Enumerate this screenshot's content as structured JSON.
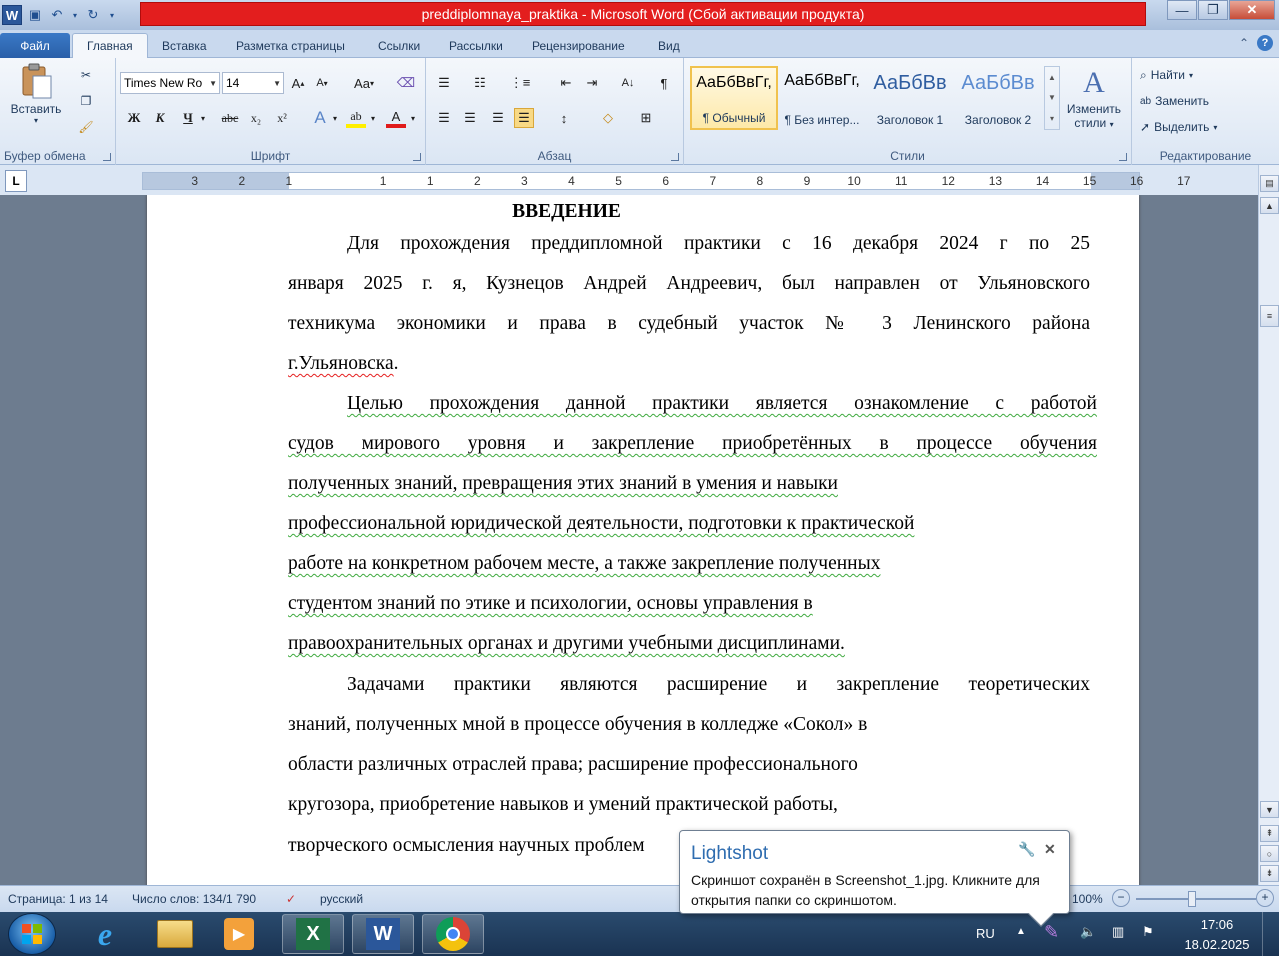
{
  "window": {
    "title": "preddiplomnaya_praktika  -  Microsoft Word (Сбой активации продукта)",
    "app_icon": "W"
  },
  "tabs": [
    "Файл",
    "Главная",
    "Вставка",
    "Разметка страницы",
    "Ссылки",
    "Рассылки",
    "Рецензирование",
    "Вид"
  ],
  "ribbon": {
    "clipboard": {
      "paste_label": "Вставить",
      "group_label": "Буфер обмена"
    },
    "font": {
      "name": "Times New Ro",
      "size": "14",
      "group_label": "Шрифт",
      "grow": "A",
      "shrink": "A",
      "case": "Aa",
      "bold": "Ж",
      "italic": "К",
      "underline": "Ч",
      "strike": "abc",
      "sub": "x₂",
      "sup": "x²"
    },
    "paragraph": {
      "group_label": "Абзац"
    },
    "styles": {
      "group_label": "Стили",
      "items": [
        {
          "sample": "АаБбВвГг,",
          "name": "¶ Обычный"
        },
        {
          "sample": "АаБбВвГг,",
          "name": "¶ Без интер..."
        },
        {
          "sample": "АаБбВв",
          "name": "Заголовок 1"
        },
        {
          "sample": "АаБбВв",
          "name": "Заголовок 2"
        }
      ],
      "change_label_1": "Изменить",
      "change_label_2": "стили"
    },
    "editing": {
      "find": "Найти",
      "replace": "Заменить",
      "select": "Выделить",
      "group_label": "Редактирование"
    }
  },
  "ruler": {
    "numbers": [
      "3",
      "2",
      "1",
      "1",
      "1",
      "2",
      "3",
      "4",
      "5",
      "6",
      "7",
      "8",
      "9",
      "10",
      "11",
      "12",
      "13",
      "14",
      "15",
      "16",
      "17"
    ]
  },
  "document": {
    "heading": "ВВЕДЕНИЕ",
    "lines": [
      "Для прохождения преддипломной практики с 16 декабря 2024 г по 25",
      "января 2025 г. я, Кузнецов Андрей Андреевич, был направлен от Ульяновского",
      "техникума   экономики   и   права   в судебный участок № 3 Ленинского района",
      "г.Ульяновска",
      ".",
      " Целью прохождения данной практики является ознакомление с работой",
      "судов мирового уровня и закрепление приобретённых в процессе обучения",
      "полученных знаний, превращения этих знаний в умения и навыки ",
      "профессиональной юридической деятельности, подготовки к практической ",
      "работе на конкретном рабочем месте, а также закрепление полученных ",
      "студентом знаний по этике и психологии, основы управления в ",
      "правоохранительных органах и другими учебными дисциплинами.",
      "Задачами практики являются расширение и закрепление теоретических",
      "знаний, полученных мной в процессе обучения в колледже «Сокол» в",
      "области различных отраслей права; расширение профессионального",
      "кругозора, приобретение навыков и умений практической работы,",
      "творческого осмысления научных проблем"
    ]
  },
  "status": {
    "page": "Страница: 1 из 14",
    "words": "Число слов: 134/1 790",
    "language": "русский",
    "zoom": "100%"
  },
  "taskbar": {
    "lang": "RU",
    "time": "17:06",
    "date": "18.02.2025"
  },
  "popup": {
    "title": "Lightshot",
    "message": "Скриншот сохранён в Screenshot_1.jpg. Кликните для открытия папки со скриншотом."
  }
}
